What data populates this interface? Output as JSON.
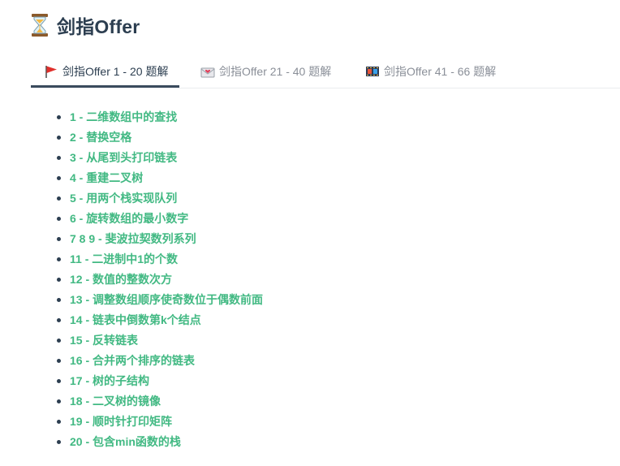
{
  "page": {
    "title": "剑指Offer",
    "title_icon": "hourglass-icon"
  },
  "tabs": [
    {
      "label": "剑指Offer 1 - 20 题解",
      "icon": "red-flag-icon",
      "active": true
    },
    {
      "label": "剑指Offer 21 - 40 题解",
      "icon": "envelope-heart-icon",
      "active": false
    },
    {
      "label": "剑指Offer 41 - 66 题解",
      "icon": "film-frames-icon",
      "active": false
    }
  ],
  "problems": [
    "1 - 二维数组中的查找",
    "2 - 替换空格",
    "3 - 从尾到头打印链表",
    "4 - 重建二叉树",
    "5 - 用两个栈实现队列",
    "6 - 旋转数组的最小数字",
    "7 8 9 - 斐波拉契数列系列",
    "11 - 二进制中1的个数",
    "12 - 数值的整数次方",
    "13 - 调整数组顺序使奇数位于偶数前面",
    "14 - 链表中倒数第k个结点",
    "15 - 反转链表",
    "16 - 合并两个排序的链表",
    "17 - 树的子结构",
    "18 - 二叉树的镜像",
    "19 - 顺时针打印矩阵",
    "20 - 包含min函数的栈"
  ],
  "colors": {
    "link": "#42b983",
    "heading": "#2c3e50",
    "tab_inactive": "#8a8f98",
    "tab_active_underline": "#3a4b5d"
  }
}
